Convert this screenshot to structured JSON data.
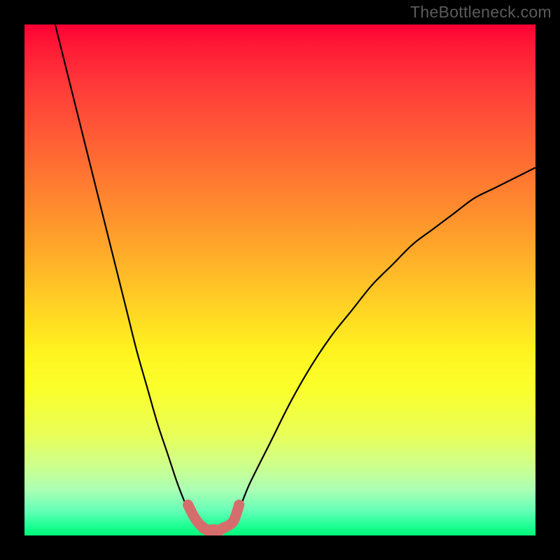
{
  "watermark": "TheBottleneck.com",
  "chart_data": {
    "type": "line",
    "title": "",
    "xlabel": "",
    "ylabel": "",
    "xlim": [
      0,
      100
    ],
    "ylim": [
      0,
      100
    ],
    "grid": false,
    "legend": false,
    "description": "Bottleneck curve (V-shape). Two black curves descend from the top edges toward a minimum near x≈37. A short series of salmon/pink dots marks the region around the minimum. Background is a vertical red→yellow→green gradient indicating bottleneck severity (red=high, green=low).",
    "series": [
      {
        "name": "left-branch",
        "x": [
          6,
          8,
          10,
          12,
          14,
          16,
          18,
          20,
          22,
          24,
          26,
          28,
          30,
          32,
          33
        ],
        "y": [
          100,
          92,
          84,
          76,
          68,
          60,
          52,
          44,
          36,
          29,
          22,
          16,
          10,
          5,
          3
        ]
      },
      {
        "name": "right-branch",
        "x": [
          41,
          42,
          44,
          48,
          52,
          56,
          60,
          64,
          68,
          72,
          76,
          80,
          84,
          88,
          92,
          96,
          100
        ],
        "y": [
          3,
          5,
          10,
          18,
          26,
          33,
          39,
          44,
          49,
          53,
          57,
          60,
          63,
          66,
          68,
          70,
          72
        ]
      },
      {
        "name": "minimum-dots",
        "x": [
          32,
          33,
          34,
          35,
          36,
          37,
          38,
          39,
          40,
          41,
          42
        ],
        "y": [
          6,
          4,
          2.5,
          1.5,
          1,
          1,
          1,
          1.5,
          2,
          3,
          6
        ]
      }
    ],
    "gradient_colors": {
      "top": "#ff0033",
      "mid": "#ffe423",
      "bottom": "#00f779"
    },
    "dot_color": "#d66d6d",
    "curve_color": "#000000"
  }
}
